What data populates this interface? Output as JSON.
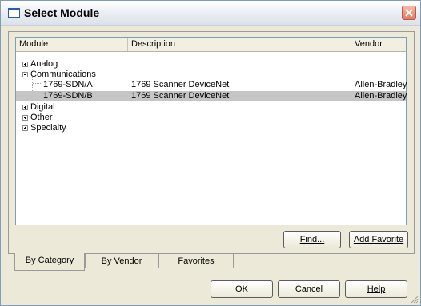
{
  "window": {
    "title": "Select Module"
  },
  "table": {
    "columns": [
      "Module",
      "Description",
      "Vendor"
    ],
    "rows": [
      {
        "module": "Analog",
        "description": "",
        "vendor": "",
        "expander": "+"
      },
      {
        "module": "Communications",
        "description": "",
        "vendor": "",
        "expander": "-"
      },
      {
        "module": "1769-SDN/A",
        "description": "1769 Scanner DeviceNet",
        "vendor": "Allen-Bradley",
        "expander": ""
      },
      {
        "module": "1769-SDN/B",
        "description": "1769 Scanner DeviceNet",
        "vendor": "Allen-Bradley",
        "expander": "",
        "selected": true
      },
      {
        "module": "Digital",
        "description": "",
        "vendor": "",
        "expander": "+"
      },
      {
        "module": "Other",
        "description": "",
        "vendor": "",
        "expander": "+"
      },
      {
        "module": "Specialty",
        "description": "",
        "vendor": "",
        "expander": "+"
      }
    ]
  },
  "buttons": {
    "find": "Find...",
    "add_favorite": "Add Favorite",
    "ok": "OK",
    "cancel": "Cancel",
    "help": "Help"
  },
  "tabs": [
    "By Category",
    "By Vendor",
    "Favorites"
  ]
}
